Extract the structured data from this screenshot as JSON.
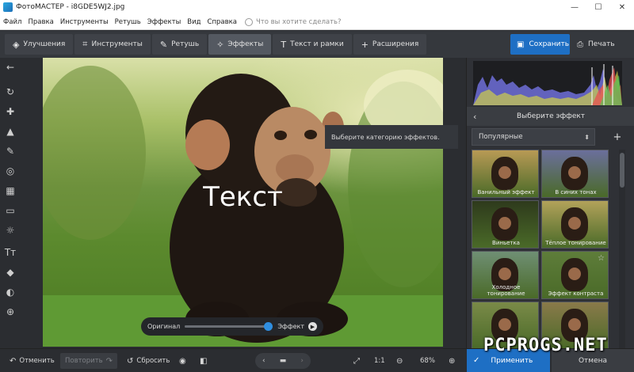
{
  "window": {
    "title": "ФотоМАСТЕР - i8GDE5WJ2.jpg",
    "min": "—",
    "max": "☐",
    "close": "✕"
  },
  "menu": {
    "items": [
      "Файл",
      "Правка",
      "Инструменты",
      "Ретушь",
      "Эффекты",
      "Вид",
      "Справка"
    ],
    "search_placeholder": "Что вы хотите сделать?"
  },
  "toolbar": {
    "tabs": [
      {
        "label": "Улучшения",
        "icon": "layers-icon"
      },
      {
        "label": "Инструменты",
        "icon": "crop-icon"
      },
      {
        "label": "Ретушь",
        "icon": "brush-icon"
      },
      {
        "label": "Эффекты",
        "icon": "magic-wand-icon",
        "active": true
      },
      {
        "label": "Текст и рамки",
        "icon": "text-icon"
      },
      {
        "label": "Расширения",
        "icon": "plus-icon"
      }
    ],
    "save_label": "Сохранить",
    "print_label": "Печать"
  },
  "left_tools": [
    "back-arrow-icon",
    "rotate-icon",
    "bandage-icon",
    "stamp-icon",
    "brush-icon",
    "radial-icon",
    "gradient-icon",
    "vignette-icon",
    "sun-icon",
    "text-icon",
    "fill-icon",
    "blur-icon",
    "globe-icon"
  ],
  "canvas": {
    "photo_text": "Текст",
    "compare_original": "Оригинал",
    "compare_effect": "Эффект",
    "compare_level": 0.95
  },
  "tooltip": "Выберите категорию эффектов.",
  "right_panel": {
    "header": "Выберите эффект",
    "dropdown_value": "Популярные",
    "effects": [
      {
        "label": "Ванильный эффект",
        "tint": "#b89a55"
      },
      {
        "label": "В синих тонах",
        "tint": "#6b6f9c"
      },
      {
        "label": "Виньетка",
        "tint": "#2e3a1c"
      },
      {
        "label": "Тёплое тонирование",
        "tint": "#b2a25a"
      },
      {
        "label": "Холодное тонирование",
        "tint": "#6f8f74"
      },
      {
        "label": "Эффект контраста",
        "tint": "#5e7d3a",
        "starred": true
      },
      {
        "label": "",
        "tint": "#7a8a48"
      },
      {
        "label": "",
        "tint": "#8a7a4a"
      }
    ]
  },
  "bottom": {
    "undo": "Отменить",
    "redo": "Повторить",
    "reset": "Сбросить",
    "zoom_fit": "1:1",
    "zoom_level": "68%",
    "apply": "Применить",
    "cancel": "Отмена"
  },
  "watermark": "PCPROGS.NET",
  "colors": {
    "accent": "#1e6fc4",
    "panel": "#2f3136",
    "toolbar": "#35383d"
  }
}
